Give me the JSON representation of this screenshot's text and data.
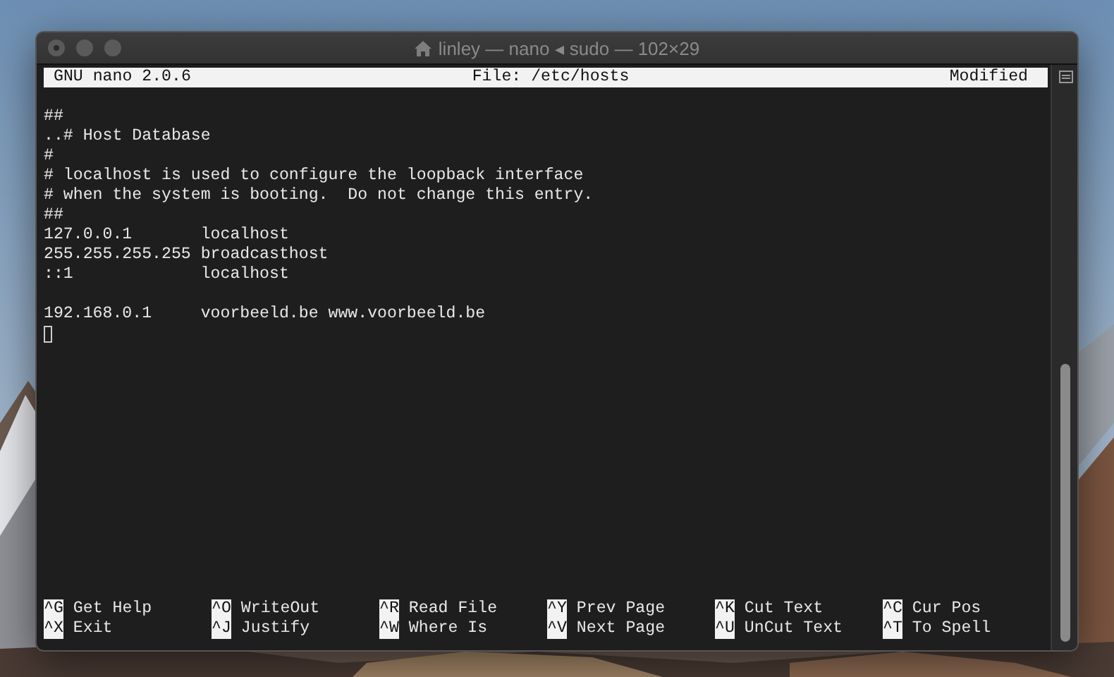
{
  "window": {
    "title": "linley — nano ◂ sudo — 102×29"
  },
  "nano_header": {
    "version": "GNU nano 2.0.6",
    "file": "File: /etc/hosts",
    "status": "Modified"
  },
  "blocks": [
    [
      "##",
      "..# Host Database",
      "#",
      "# localhost is used to configure the loopback interface",
      "# when the system is booting.  Do not change this entry.",
      "##",
      "127.0.0.1       localhost",
      "255.255.255.255 broadcasthost",
      "::1             localhost"
    ],
    [
      "192.168.0.1     voorbeeld.be www.voorbeeld.be"
    ]
  ],
  "shortcut_rows": [
    [
      {
        "key": "^G",
        "label": "Get Help"
      },
      {
        "key": "^O",
        "label": "WriteOut"
      },
      {
        "key": "^R",
        "label": "Read File"
      },
      {
        "key": "^Y",
        "label": "Prev Page"
      },
      {
        "key": "^K",
        "label": "Cut Text"
      },
      {
        "key": "^C",
        "label": "Cur Pos"
      }
    ],
    [
      {
        "key": "^X",
        "label": "Exit"
      },
      {
        "key": "^J",
        "label": "Justify"
      },
      {
        "key": "^W",
        "label": "Where Is"
      },
      {
        "key": "^V",
        "label": "Next Page"
      },
      {
        "key": "^U",
        "label": "UnCut Text"
      },
      {
        "key": "^T",
        "label": "To Spell"
      }
    ]
  ]
}
